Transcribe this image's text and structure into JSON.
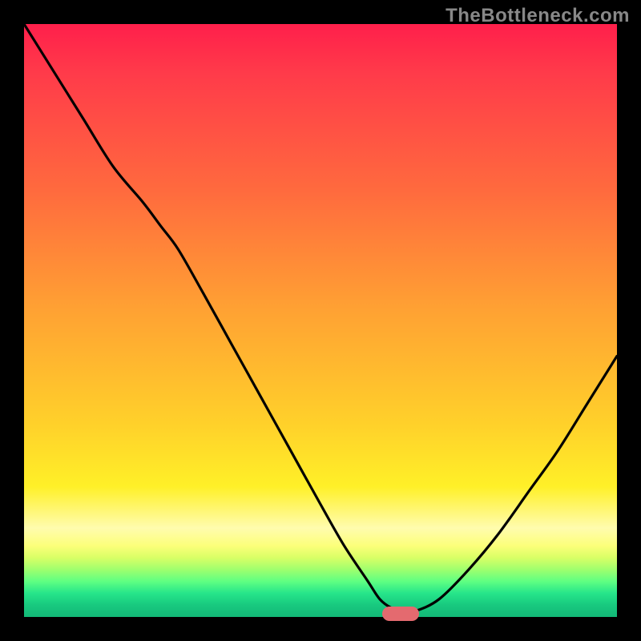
{
  "watermark": "TheBottleneck.com",
  "chart_data": {
    "type": "line",
    "title": "",
    "xlabel": "",
    "ylabel": "",
    "x": [
      0.0,
      0.05,
      0.1,
      0.15,
      0.2,
      0.23,
      0.26,
      0.3,
      0.35,
      0.4,
      0.45,
      0.5,
      0.54,
      0.58,
      0.6,
      0.62,
      0.64,
      0.66,
      0.7,
      0.75,
      0.8,
      0.85,
      0.9,
      0.95,
      1.0
    ],
    "y": [
      1.0,
      0.92,
      0.84,
      0.76,
      0.7,
      0.66,
      0.62,
      0.55,
      0.46,
      0.37,
      0.28,
      0.19,
      0.12,
      0.06,
      0.03,
      0.015,
      0.01,
      0.01,
      0.03,
      0.08,
      0.14,
      0.21,
      0.28,
      0.36,
      0.44
    ],
    "xlim": [
      0,
      1
    ],
    "ylim": [
      0,
      1
    ],
    "curve_note": "V-shaped bottleneck curve. Minimum near x≈0.63. y=0 is bottom (green), y=1 is top (red).",
    "marker": {
      "x": 0.635,
      "y": 0.005,
      "shape": "pill",
      "color": "#e46a6f"
    },
    "background_gradient": {
      "top": "#ff1f4b",
      "mid": "#ffd22a",
      "low_band": "#fffcae",
      "bottom": "#13b877"
    }
  }
}
